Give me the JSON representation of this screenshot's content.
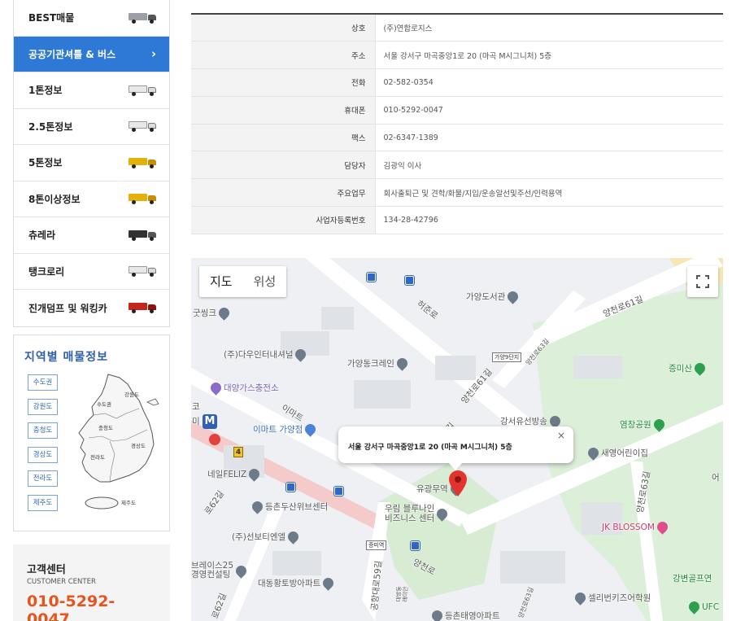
{
  "sidebar": {
    "menu": [
      {
        "label": "BEST매물",
        "icon": "gray"
      },
      {
        "label": "공공기관셔틀 & 버스",
        "icon": "chevron"
      },
      {
        "label": "1톤정보",
        "icon": "white"
      },
      {
        "label": "2.5톤정보",
        "icon": "white"
      },
      {
        "label": "5톤정보",
        "icon": "yellow"
      },
      {
        "label": "8톤이상정보",
        "icon": "yellow"
      },
      {
        "label": "츄레라",
        "icon": "dark"
      },
      {
        "label": "탱크로리",
        "icon": "white"
      },
      {
        "label": "진개덤프 및 워킹카",
        "icon": "red"
      }
    ],
    "chevron": "›",
    "region": {
      "title": "지역별 매물정보",
      "buttons": [
        "수도권",
        "강원도",
        "충청도",
        "경상도",
        "전라도",
        "제주도"
      ],
      "map_labels": [
        "수도권",
        "강원도",
        "충청도",
        "경상도",
        "전라도",
        "제주도"
      ]
    },
    "customer_center": {
      "title": "고객센터",
      "subtitle": "CUSTOMER CENTER",
      "phone": "010-5292-0047"
    }
  },
  "company_info": [
    {
      "label": "상호",
      "value": "(주)연합로지스"
    },
    {
      "label": "주소",
      "value": "서울 강서구 마곡중앙1로 20 (마곡 M시그니처) 5층"
    },
    {
      "label": "전화",
      "value": "02-582-0354"
    },
    {
      "label": "휴대폰",
      "value": "010-5292-0047"
    },
    {
      "label": "팩스",
      "value": "02-6347-1389"
    },
    {
      "label": "담당자",
      "value": "김광익 이사"
    },
    {
      "label": "주요업무",
      "value": "회사출퇴근 및 견학/화물/지입/운송알선및주선/인력용역"
    },
    {
      "label": "사업자등록번호",
      "value": "134-28-42796"
    }
  ],
  "map": {
    "type_buttons": [
      "지도",
      "위성"
    ],
    "info_window": "서울 강서구 마곡중앙1로 20 (마곡 M시그니처) 5층",
    "close": "×",
    "station_badge": "M",
    "exit_badge": "4",
    "tags": [
      "가양9단지",
      "증미역"
    ],
    "pois": {
      "gayang_library": "가양도서관",
      "goodsink": "굿씽크",
      "daum_interior": "(주)다우인터내셔널",
      "gayang_crane": "가양동크레인",
      "daeyang_gas": "대양가스충전소",
      "emart": "이마트 가양점",
      "emart_short": "이마트",
      "gangseo_broadcast": "강서유선방송",
      "jeungmisan": "증미산",
      "yeomchang_park": "염창공원",
      "saeyoung_daycare": "새영어린이집",
      "neil_feliz": "네일FELIZ",
      "dungchon_center": "등촌두산위브센터",
      "yugwang": "유광무역",
      "woorim": "우림 블루나인\n비즈니스 센터",
      "sunbo": "(주)선보티엔엘",
      "jk_blossom": "JK BLOSSOM",
      "brace": "브레이스25\n경영컨설팅",
      "daedong": "대동황토방아파트",
      "selly_kids": "셀리번키즈어학원",
      "dungchon_taeyeong": "등촌태영아파트",
      "gangbyeon_golf": "강변골프연",
      "ufc": "UFC",
      "left_edge_1": "코",
      "left_edge_2": "미",
      "right_edge": "어"
    },
    "roads": {
      "heojun": "허준로",
      "yangcheon61": "양천로61길",
      "yangcheon61b": "양천로61길",
      "yangcheon63": "양천로63길",
      "yangcheon63b": "양천로63길",
      "yangcheon": "양천로",
      "gonghang59": "공항대로59길",
      "road62": "로62길",
      "road62b": "로62길",
      "road63": "양천로63길",
      "gil": "길",
      "small": "대방동\n래미안"
    }
  }
}
